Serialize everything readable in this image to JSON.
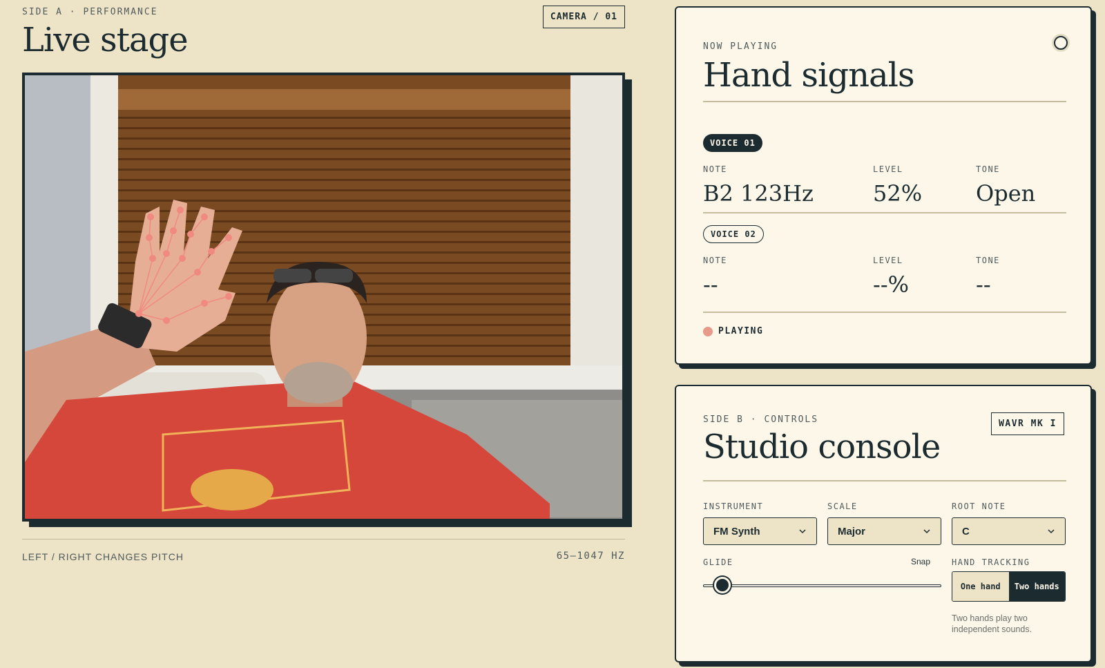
{
  "stage": {
    "eyebrow": "SIDE A · PERFORMANCE",
    "title": "Live stage",
    "camera_tag": "CAMERA / 01",
    "footer_left": "LEFT / RIGHT CHANGES PITCH",
    "footer_right": "65–1047 HZ"
  },
  "now_playing": {
    "eyebrow": "NOW PLAYING",
    "title": "Hand signals",
    "voices": [
      {
        "pill": "VOICE 01",
        "note_label": "NOTE",
        "note": "B2 123Hz",
        "level_label": "LEVEL",
        "level": "52%",
        "tone_label": "TONE",
        "tone": "Open"
      },
      {
        "pill": "VOICE 02",
        "note_label": "NOTE",
        "note": "--",
        "level_label": "LEVEL",
        "level": "--%",
        "tone_label": "TONE",
        "tone": "--"
      }
    ],
    "status": "PLAYING"
  },
  "console": {
    "eyebrow": "SIDE B · CONTROLS",
    "title": "Studio console",
    "model_tag": "WAVR MK I",
    "instrument_label": "INSTRUMENT",
    "instrument_value": "FM Synth",
    "scale_label": "SCALE",
    "scale_value": "Major",
    "root_label": "ROOT NOTE",
    "root_value": "C",
    "glide_label": "GLIDE",
    "glide_end_label": "Snap",
    "glide_value": 0.07,
    "hand_tracking_label": "HAND TRACKING",
    "hand_options": [
      "One hand",
      "Two hands"
    ],
    "hand_selected": "Two hands",
    "hand_note": "Two hands play two independent sounds."
  },
  "colors": {
    "background": "#ede3c6",
    "card": "#fcf7e8",
    "ink": "#1c2b30",
    "accent": "#e79a8a",
    "landmark": "#f08a80"
  }
}
